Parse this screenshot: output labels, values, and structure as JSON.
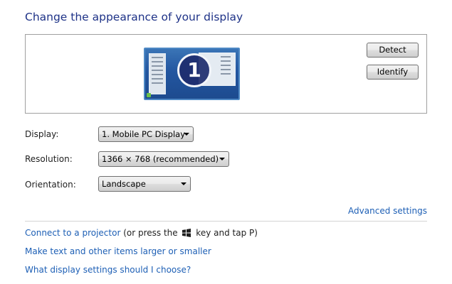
{
  "page": {
    "title": "Change the appearance of your display"
  },
  "preview": {
    "monitor_number": "1",
    "detect_label": "Detect",
    "identify_label": "Identify"
  },
  "settings": {
    "display_label": "Display:",
    "display_value": "1. Mobile PC Display",
    "resolution_label": "Resolution:",
    "resolution_value": "1366 × 768 (recommended)",
    "orientation_label": "Orientation:",
    "orientation_value": "Landscape"
  },
  "advanced_link": "Advanced settings",
  "links": {
    "projector_link": "Connect to a projector",
    "projector_hint_before": " (or press the ",
    "projector_hint_after": " key and tap P)",
    "text_size_link": "Make text and other items larger or smaller",
    "help_link": "What display settings should I choose?"
  },
  "icons": {
    "windows_key": "windows-logo-icon",
    "dropdown_arrow": "chevron-down-icon"
  }
}
